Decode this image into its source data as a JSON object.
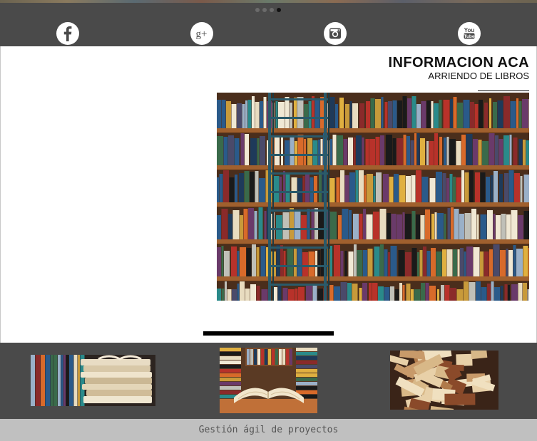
{
  "carousel": {
    "dot_count": 4,
    "active_index": 3
  },
  "social": [
    {
      "name": "facebook",
      "icon": "facebook-icon"
    },
    {
      "name": "google-plus",
      "icon": "google-plus-icon",
      "glyph": "g+"
    },
    {
      "name": "instagram",
      "icon": "instagram-icon"
    },
    {
      "name": "youtube",
      "icon": "youtube-icon",
      "glyph_top": "You",
      "glyph_bottom": "Tube"
    }
  ],
  "content": {
    "title": "INFORMACION ACA",
    "subtitle": "ARRIENDO DE LIBROS"
  },
  "images": {
    "hero": "bookshelf-with-ladder-photo",
    "thumbnails": [
      "stacked-books-photo",
      "open-book-photo",
      "pile-of-books-photo"
    ]
  },
  "footer": {
    "text": "Gestión ágil de proyectos"
  },
  "colors": {
    "bar": "#4a4a4a",
    "footer": "#c0c0c0",
    "accent": "#000000"
  }
}
